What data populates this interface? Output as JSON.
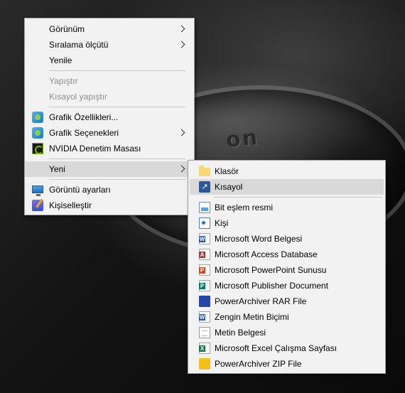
{
  "background": {
    "brand_text": "on"
  },
  "context_menu": {
    "items": [
      {
        "label": "Görünüm",
        "submenu": true,
        "enabled": true
      },
      {
        "label": "Sıralama ölçütü",
        "submenu": true,
        "enabled": true
      },
      {
        "label": "Yenile",
        "enabled": true
      },
      {
        "label": "Yapıştır",
        "enabled": false
      },
      {
        "label": "Kısayol yapıştır",
        "enabled": false
      },
      {
        "label": "Grafik Özellikleri...",
        "icon": "graphics-icon",
        "enabled": true
      },
      {
        "label": "Grafik Seçenekleri",
        "icon": "graphics-icon",
        "submenu": true,
        "enabled": true
      },
      {
        "label": "NVIDIA Denetim Masası",
        "icon": "nvidia-icon",
        "enabled": true
      },
      {
        "label": "Yeni",
        "submenu": true,
        "highlighted": true,
        "enabled": true
      },
      {
        "label": "Görüntü ayarları",
        "icon": "display-settings-icon",
        "enabled": true
      },
      {
        "label": "Kişiselleştir",
        "icon": "personalize-icon",
        "enabled": true
      }
    ]
  },
  "new_submenu": {
    "items": [
      {
        "label": "Klasör",
        "icon": "folder-icon"
      },
      {
        "label": "Kısayol",
        "icon": "shortcut-icon",
        "highlighted": true
      },
      {
        "label": "Bit eşlem resmi",
        "icon": "bitmap-icon"
      },
      {
        "label": "Kişi",
        "icon": "contact-icon"
      },
      {
        "label": "Microsoft Word Belgesi",
        "icon": "word-icon"
      },
      {
        "label": "Microsoft Access Database",
        "icon": "access-icon"
      },
      {
        "label": "Microsoft PowerPoint Sunusu",
        "icon": "powerpoint-icon"
      },
      {
        "label": "Microsoft Publisher Document",
        "icon": "publisher-icon"
      },
      {
        "label": "PowerArchiver RAR File",
        "icon": "rar-icon"
      },
      {
        "label": "Zengin Metin Biçimi",
        "icon": "rtf-icon"
      },
      {
        "label": "Metin Belgesi",
        "icon": "text-icon"
      },
      {
        "label": "Microsoft Excel Çalışma Sayfası",
        "icon": "excel-icon"
      },
      {
        "label": "PowerArchiver ZIP File",
        "icon": "zip-icon"
      }
    ]
  },
  "colors": {
    "menu_bg": "#f2f2f2",
    "highlight": "#d9d9d9",
    "disabled_text": "#8e8e8e",
    "word": "#2b579a",
    "access": "#a4373a",
    "powerpoint": "#d24726",
    "publisher": "#077568",
    "excel": "#217346"
  }
}
